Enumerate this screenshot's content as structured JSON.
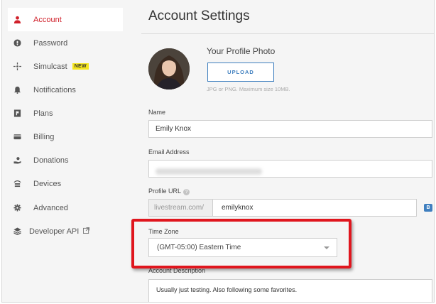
{
  "sidebar": {
    "items": [
      {
        "label": "Account",
        "icon": "user-icon",
        "active": true
      },
      {
        "label": "Password",
        "icon": "lock-icon"
      },
      {
        "label": "Simulcast",
        "icon": "broadcast-icon",
        "badge": "NEW"
      },
      {
        "label": "Notifications",
        "icon": "bell-icon"
      },
      {
        "label": "Plans",
        "icon": "plans-icon"
      },
      {
        "label": "Billing",
        "icon": "card-icon"
      },
      {
        "label": "Donations",
        "icon": "donation-icon"
      },
      {
        "label": "Devices",
        "icon": "devices-icon"
      },
      {
        "label": "Advanced",
        "icon": "gear-icon"
      },
      {
        "label": "Developer API",
        "icon": "layers-icon",
        "external": "external-link-icon"
      }
    ]
  },
  "main": {
    "title": "Account Settings",
    "photo": {
      "title": "Your Profile Photo",
      "upload_label": "UPLOAD",
      "hint": "JPG or PNG. Maximum size 10MB."
    },
    "name": {
      "label": "Name",
      "value": "Emily Knox"
    },
    "email": {
      "label": "Email Address"
    },
    "profile_url": {
      "label": "Profile URL",
      "help": "?",
      "prefix": "livestream.com/",
      "value": "emilyknox",
      "badge": "B"
    },
    "time_zone": {
      "label": "Time Zone",
      "value": "(GMT-05:00) Eastern Time"
    },
    "description": {
      "label": "Account Description",
      "value": "Usually just testing. Also following some favorites."
    }
  },
  "colors": {
    "accent": "#d0202a",
    "link_blue": "#3f7fbf",
    "highlight": "#e0161e",
    "badge_yellow": "#f5e61f"
  }
}
